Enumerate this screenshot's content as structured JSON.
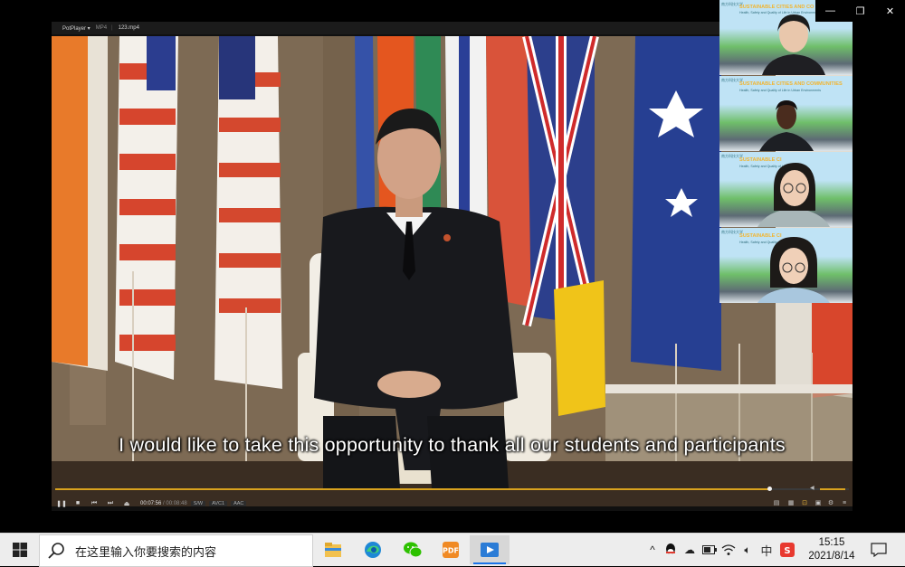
{
  "player": {
    "app_name": "PotPlayer",
    "format": "MP4",
    "file_name": "123.mp4",
    "subtitle": "I would like to take this opportunity to thank all our students and participants",
    "current_time": "00:07:56",
    "total_time": "/ 00:08:48",
    "progress": 0.9,
    "volume": 1.0,
    "badges": [
      "S/W",
      "AVC1",
      "AAC"
    ]
  },
  "participants": [
    {
      "banner_title": "SUSTAINABLE CITIES AND CO",
      "banner_sub": "Health, Safety and Quality of Life in Urban Environments",
      "logo": "南方科技大学"
    },
    {
      "banner_title": "SUSTAINABLE CITIES AND COMMUNITIES",
      "banner_sub": "Health, Safety and Quality of Life in Urban Environments",
      "logo": "南方科技大学"
    },
    {
      "banner_title": "SUSTAINABLE CI",
      "banner_sub": "Health, Safety and Quality of Life",
      "logo": "南方科技大学"
    },
    {
      "banner_title": "SUSTAINABLE CI",
      "banner_sub": "Health, Safety and Quality of Life",
      "logo": "南方科技大学"
    }
  ],
  "taskbar": {
    "search_placeholder": "在这里输入你要搜索的内容",
    "ime_label": "中",
    "time": "15:15",
    "date": "2021/8/14",
    "apps": [
      "file-explorer-icon",
      "edge-icon",
      "wechat-icon",
      "app-icon",
      "potplayer-icon"
    ]
  },
  "colors": {
    "accent": "#d8a21e",
    "taskbar_bg": "#ededed",
    "active_indicator": "#1a73e8"
  }
}
